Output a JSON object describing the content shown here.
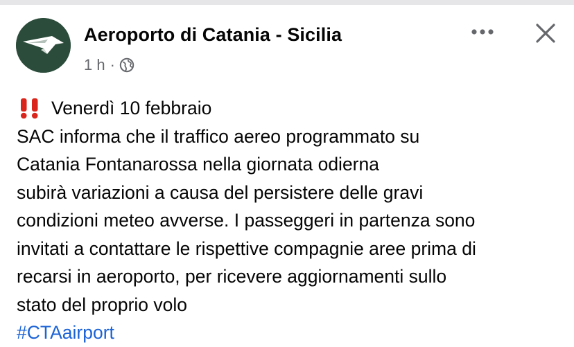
{
  "post": {
    "page_name": "Aeroporto di Catania - Sicilia",
    "time": "1 h",
    "separator": "·",
    "audience_icon": "globe-icon",
    "avatar_icon": "airport-logo",
    "more_icon": "more-options-icon",
    "close_icon": "close-icon",
    "headline": "Venerdì 10 febbraio",
    "headline_icon": "double-exclamation-icon",
    "body_lines": [
      "SAC informa che il traffico aereo programmato su",
      "Catania Fontanarossa nella giornata odierna",
      "subirà variazioni a causa del persistere delle gravi",
      "condizioni meteo avverse. I passeggeri in partenza sono",
      "invitati a contattare le rispettive compagnie aree prima di",
      "recarsi in aeroporto, per ricevere aggiornamenti sullo",
      "stato del proprio volo"
    ],
    "hashtag": "#CTAairport"
  },
  "colors": {
    "avatar_bg": "#2c4c3b",
    "text": "#050505",
    "secondary_text": "#65676b",
    "link": "#1b63d6",
    "exclamation": "#d9251b"
  }
}
